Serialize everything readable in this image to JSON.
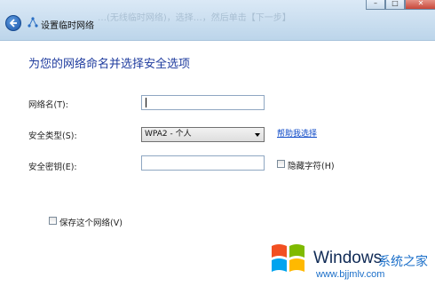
{
  "window": {
    "title": "设置临时网络",
    "ghost_text": "…(无线临时网络)，选择…，然后单击【下一步】"
  },
  "page": {
    "heading": "为您的网络命名并选择安全选项"
  },
  "form": {
    "network_name_label": "网络名(T):",
    "network_name_value": "",
    "security_type_label": "安全类型(S):",
    "security_type_value": "WPA2 - 个人",
    "help_link": "帮助我选择",
    "security_key_label": "安全密钥(E):",
    "security_key_value": "",
    "hide_chars_label": "隐藏字符(H)",
    "save_network_label": "保存这个网络(V)"
  },
  "watermark": {
    "brand": "Windows",
    "site_cn": "系统之家",
    "url": "www.bjjmlv.com",
    "colors": [
      "#f25022",
      "#7fba00",
      "#00a4ef",
      "#ffb900"
    ]
  }
}
